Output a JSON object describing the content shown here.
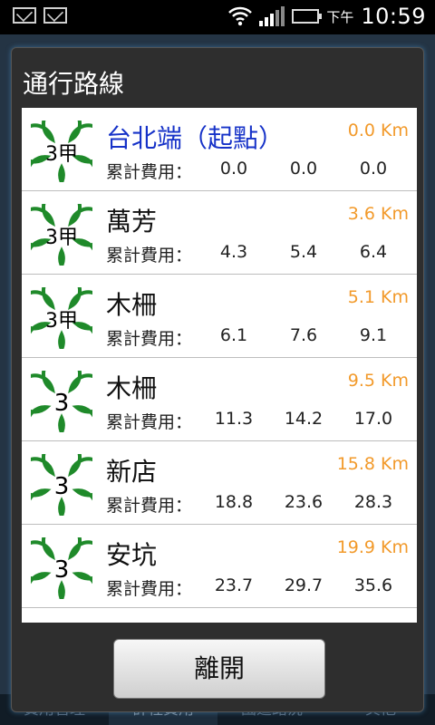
{
  "status_bar": {
    "icons": [
      "gmail-icon",
      "gmail-icon",
      "wifi-icon",
      "signal-icon",
      "battery-icon"
    ],
    "ampm": "下午",
    "time": "10:59",
    "battery_color": "#3ec43e"
  },
  "background": {
    "tabs": [
      "費用管理",
      "計程費用",
      "國道路況",
      "其他"
    ]
  },
  "dialog": {
    "title": "通行路線",
    "fee_label": "累計費用：",
    "leave_button": "離開",
    "distance_color": "#f29a2b",
    "start_color": "#1632c8",
    "routes": [
      {
        "badge": "3甲",
        "name": "台北端（起點）",
        "distance": "0.0 Km",
        "fees": [
          "0.0",
          "0.0",
          "0.0"
        ],
        "is_start": true
      },
      {
        "badge": "3甲",
        "name": "萬芳",
        "distance": "3.6 Km",
        "fees": [
          "4.3",
          "5.4",
          "6.4"
        ]
      },
      {
        "badge": "3甲",
        "name": "木柵",
        "distance": "5.1 Km",
        "fees": [
          "6.1",
          "7.6",
          "9.1"
        ]
      },
      {
        "badge": "3",
        "name": "木柵",
        "distance": "9.5 Km",
        "fees": [
          "11.3",
          "14.2",
          "17.0"
        ]
      },
      {
        "badge": "3",
        "name": "新店",
        "distance": "15.8 Km",
        "fees": [
          "18.8",
          "23.6",
          "28.3"
        ]
      },
      {
        "badge": "3",
        "name": "安坑",
        "distance": "19.9 Km",
        "fees": [
          "23.7",
          "29.7",
          "35.6"
        ]
      }
    ]
  }
}
